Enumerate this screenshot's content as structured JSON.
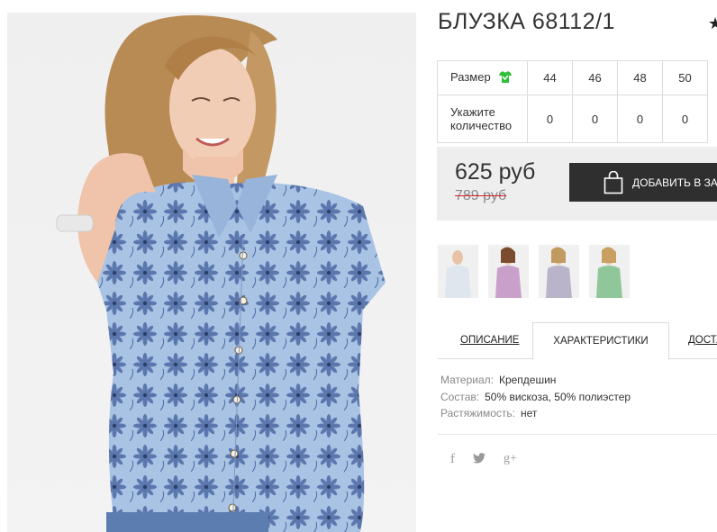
{
  "product": {
    "title": "БЛУЗКА 68112/1",
    "photo_icon": "product-photo"
  },
  "sizes": {
    "size_label": "Размер",
    "qty_label_1": "Укажите",
    "qty_label_2": "количество",
    "columns": [
      "44",
      "46",
      "48",
      "50"
    ],
    "quantities": [
      "0",
      "0",
      "0",
      "0"
    ]
  },
  "price": {
    "current": "625 руб",
    "old": "789 руб",
    "add_to_cart": "ДОБАВИТЬ В ЗА"
  },
  "tabs": {
    "description": "ОПИСАНИЕ",
    "characteristics": "ХАРАКТЕРИСТИКИ",
    "delivery": "ДОСТА"
  },
  "specs": [
    {
      "key": "Материал:",
      "value": "Крепдешин"
    },
    {
      "key": "Состав:",
      "value": "50% вискоза, 50% полиэстер"
    },
    {
      "key": "Растяжимость:",
      "value": "нет"
    }
  ],
  "social": {
    "facebook": "f",
    "google": "g+"
  },
  "colors": {
    "cart_button": "#2f2f2f",
    "price_box": "#eeeeee",
    "strike": "#dd2222",
    "size_icon": "#2fbf3a"
  }
}
